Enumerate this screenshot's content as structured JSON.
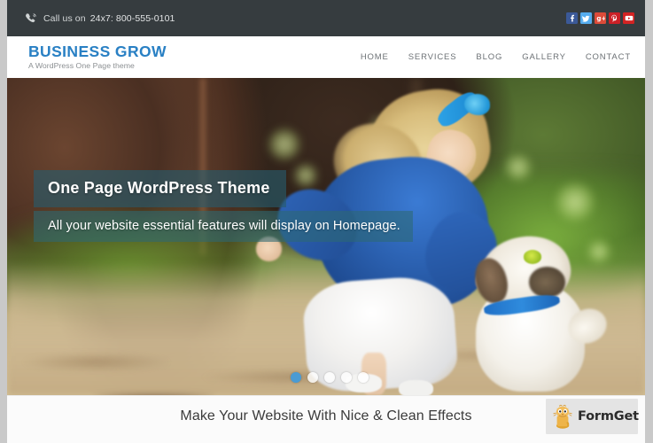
{
  "topbar": {
    "phone_icon": "phone-icon",
    "call_label": "Call us on",
    "phone_number": "24x7: 800-555-0101",
    "socials": [
      {
        "name": "facebook",
        "glyph": "f",
        "color": "#3b5998"
      },
      {
        "name": "twitter",
        "glyph": "t",
        "color": "#55acee"
      },
      {
        "name": "google-plus",
        "glyph": "g+",
        "color": "#dd4b39"
      },
      {
        "name": "pinterest",
        "glyph": "P",
        "color": "#cb2027"
      },
      {
        "name": "youtube",
        "glyph": "▶",
        "color": "#d32323"
      }
    ]
  },
  "header": {
    "brand_title": "BUSINESS GROW",
    "brand_subtitle": "A WordPress One Page theme",
    "brand_color": "#2980c4",
    "nav": [
      {
        "label": "HOME"
      },
      {
        "label": "SERVICES"
      },
      {
        "label": "BLOG"
      },
      {
        "label": "GALLERY"
      },
      {
        "label": "CONTACT"
      }
    ]
  },
  "hero": {
    "caption_title": "One Page WordPress Theme",
    "caption_subtitle": "All your website essential features will display on Homepage.",
    "slider_dots": [
      {
        "active": true
      },
      {
        "active": false
      },
      {
        "active": false
      },
      {
        "active": false
      },
      {
        "active": false
      }
    ],
    "active_dot_color": "#4a9bd4"
  },
  "caption_bar": {
    "text": "Make Your Website With Nice & Clean Effects"
  },
  "watermark": {
    "brand": "FormGet",
    "logo_icon": "formget-cat-logo"
  }
}
